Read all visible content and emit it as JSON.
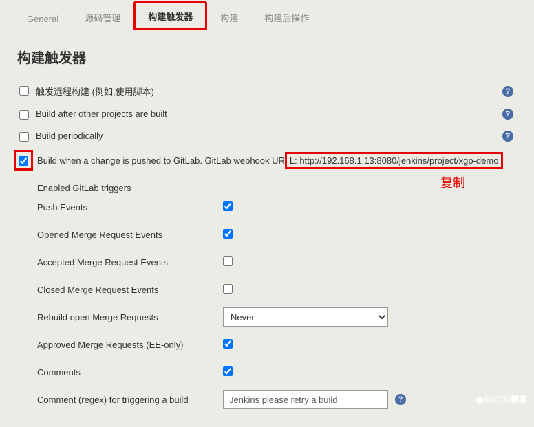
{
  "tabs": {
    "general": "General",
    "source": "源码管理",
    "triggers": "构建触发器",
    "build": "构建",
    "postbuild": "构建后操作"
  },
  "section_title": "构建触发器",
  "rows": {
    "remote": "触发远程构建 (例如,使用脚本)",
    "after_other": "Build after other projects are built",
    "periodically": "Build periodically",
    "gitlab_prefix": "Build when a change is pushed to GitLab. GitLab webhook UR",
    "gitlab_url": "L: http://192.168.1.13:8080/jenkins/project/xgp-demo"
  },
  "copy_label": "复制",
  "triggers_label": "Enabled GitLab triggers",
  "trigger_rows": {
    "push": "Push Events",
    "opened_mr": "Opened Merge Request Events",
    "accepted_mr": "Accepted Merge Request Events",
    "closed_mr": "Closed Merge Request Events",
    "rebuild_mr": "Rebuild open Merge Requests",
    "approved_mr": "Approved Merge Requests (EE-only)",
    "comments": "Comments",
    "comment_regex": "Comment (regex) for triggering a build"
  },
  "rebuild_select": "Never",
  "comment_regex_value": "Jenkins please retry a build",
  "watermark": "51CTO博客"
}
